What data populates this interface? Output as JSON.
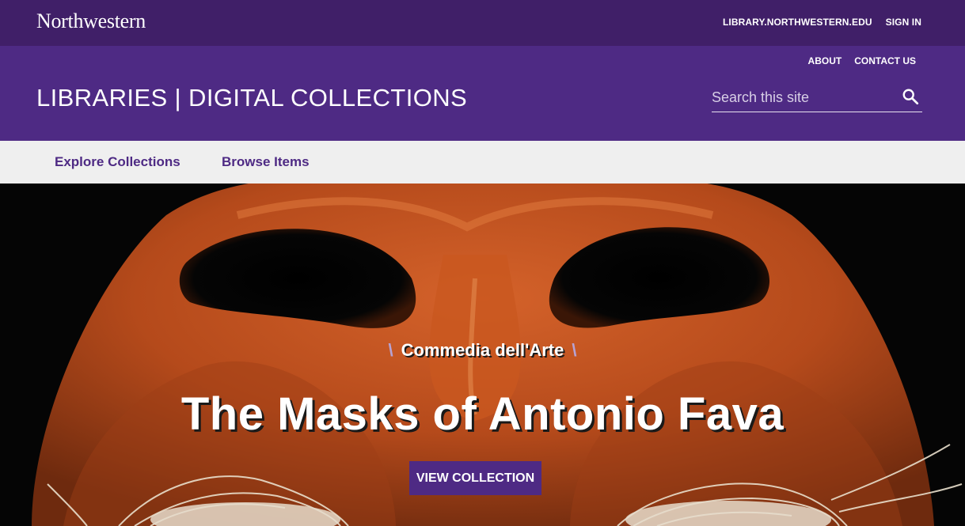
{
  "top_bar": {
    "brand": "Northwestern",
    "links": [
      "LIBRARY.NORTHWESTERN.EDU",
      "SIGN IN"
    ]
  },
  "header": {
    "secondary_links": [
      "ABOUT",
      "CONTACT US"
    ],
    "site_title": "LIBRARIES | DIGITAL COLLECTIONS",
    "search_placeholder": "Search this site",
    "search_icon": "search-icon"
  },
  "main_nav": {
    "items": [
      "Explore Collections",
      "Browse Items"
    ]
  },
  "hero": {
    "eyebrow": "Commedia dell'Arte",
    "title": "The Masks of Antonio Fava",
    "button_label": "VIEW COLLECTION",
    "image": "orange-leather-mask"
  },
  "colors": {
    "top_bar": "#401f68",
    "header": "#4e2a84",
    "nav_background": "#efefef",
    "accent_text": "#4e2a84",
    "mask": "#c2521e"
  }
}
